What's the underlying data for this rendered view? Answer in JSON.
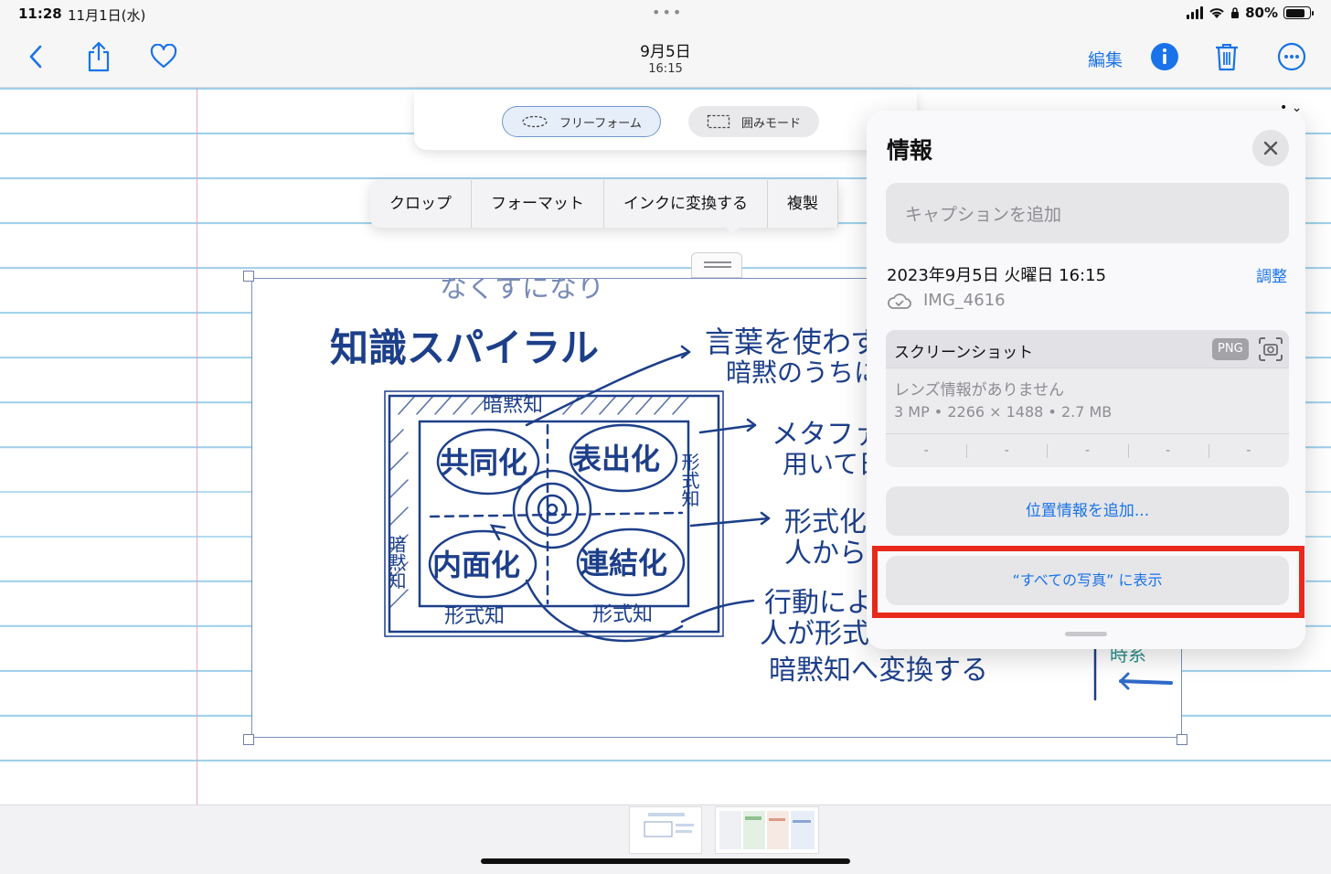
{
  "status_bar": {
    "time": "11:28",
    "date": "11月1日(水)",
    "battery": "80%",
    "battery_level": 0.8
  },
  "toolbar": {
    "title": "9月5日",
    "subtitle": "16:15",
    "edit_label": "編集",
    "icons": [
      "chevron-left-icon",
      "share-icon",
      "heart-icon",
      "info-icon",
      "trash-icon",
      "more-icon"
    ]
  },
  "lasso_modes": {
    "freeform": "フリーフォーム",
    "rectangle": "囲みモード"
  },
  "context_menu": {
    "items": [
      "クロップ",
      "フォーマット",
      "インクに変換する",
      "複製"
    ]
  },
  "sketch": {
    "fragment_top": "なくすになり",
    "title": "知識スパイラル",
    "tacit_top": "暗黙知",
    "quadrants": [
      "共同化",
      "表出化",
      "内面化",
      "連結化"
    ],
    "side_explicit": "形式知",
    "side_tacit": "暗黙知",
    "bottom_left": "形式知",
    "bottom_right": "形式知",
    "note1_line1": "言葉を使わずに",
    "note1_line2": "暗黙のうちに",
    "note2_line1": "メタファやを",
    "note2_line2": "用いて日",
    "note3_line1": "形式化",
    "note3_line2": "人から人",
    "note4_line1": "行動によ",
    "note4_line2": "人が形式",
    "note4_line3": "暗黙知へ変換する",
    "note5": "時系"
  },
  "info_panel": {
    "title": "情報",
    "caption_placeholder": "キャプションを追加",
    "datetime": "2023年9月5日 火曜日 16:15",
    "adjust_label": "調整",
    "filename": "IMG_4616",
    "meta_label": "スクリーンショット",
    "format_badge": "PNG",
    "lens_info": "レンズ情報がありません",
    "specs": "3 MP • 2266 × 1488 • 2.7 MB",
    "exif": [
      "-",
      "-",
      "-",
      "-",
      "-"
    ],
    "add_location": "位置情報を追加...",
    "show_in_all_photos": "“すべての写真” に表示"
  },
  "colors": {
    "accent": "#1a73e8",
    "highlight": "#e8291b",
    "ink": "#1d3f8a",
    "rule_line": "#9fd0ea",
    "margin_line": "#e4a9b7"
  }
}
